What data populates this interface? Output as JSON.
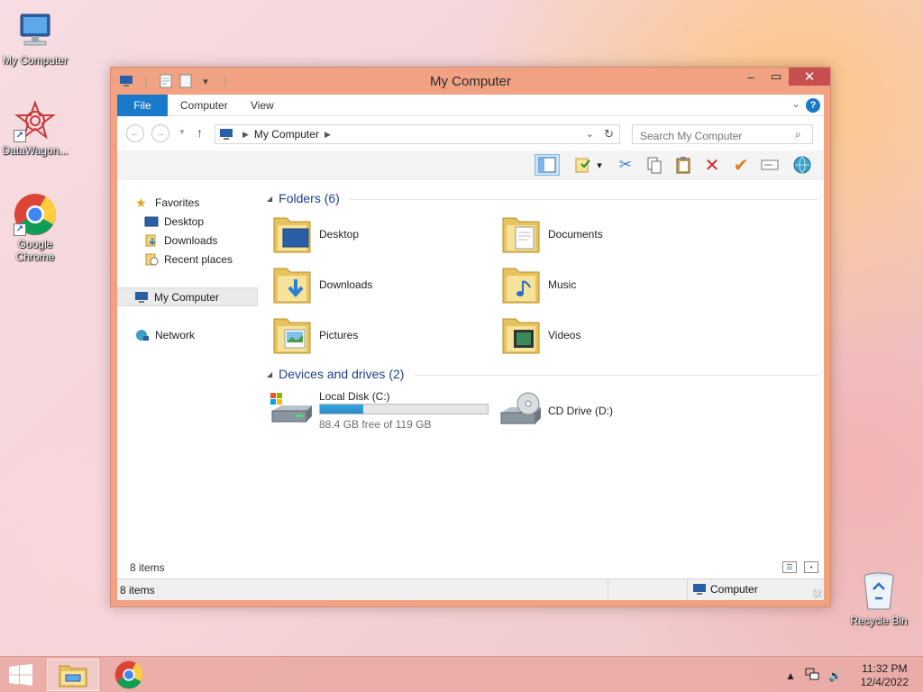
{
  "desktop": {
    "icons": [
      {
        "label": "My Computer"
      },
      {
        "label": "DataWagon..."
      },
      {
        "label": "Google Chrome"
      },
      {
        "label": "Recycle Bin"
      }
    ]
  },
  "window": {
    "title": "My Computer",
    "ribbon_tabs": [
      "File",
      "Computer",
      "View"
    ],
    "help_glyph": "?",
    "address": {
      "crumb": "My Computer"
    },
    "search": {
      "placeholder": "Search My Computer"
    },
    "nav": {
      "favorites": "Favorites",
      "desktop": "Desktop",
      "downloads": "Downloads",
      "recent_places": "Recent places",
      "my_computer": "My Computer",
      "network": "Network"
    },
    "folders_header": "Folders (6)",
    "folders": [
      {
        "name": "Desktop"
      },
      {
        "name": "Documents"
      },
      {
        "name": "Downloads"
      },
      {
        "name": "Music"
      },
      {
        "name": "Pictures"
      },
      {
        "name": "Videos"
      }
    ],
    "devices_header": "Devices and drives (2)",
    "drives": [
      {
        "name": "Local Disk (C:)",
        "free_text": "88.4 GB free of 119 GB",
        "used_fraction": 0.257
      },
      {
        "name": "CD Drive (D:)"
      }
    ],
    "inner_status": "8 items",
    "status": {
      "count": "8 items",
      "location": "Computer"
    }
  },
  "taskbar": {
    "time": "11:32 PM",
    "date": "12/4/2022"
  },
  "colors": {
    "accent": "#1979ca",
    "frame": "#f0a283",
    "close": "#c74f4f",
    "header_text": "#1e3f8c"
  }
}
